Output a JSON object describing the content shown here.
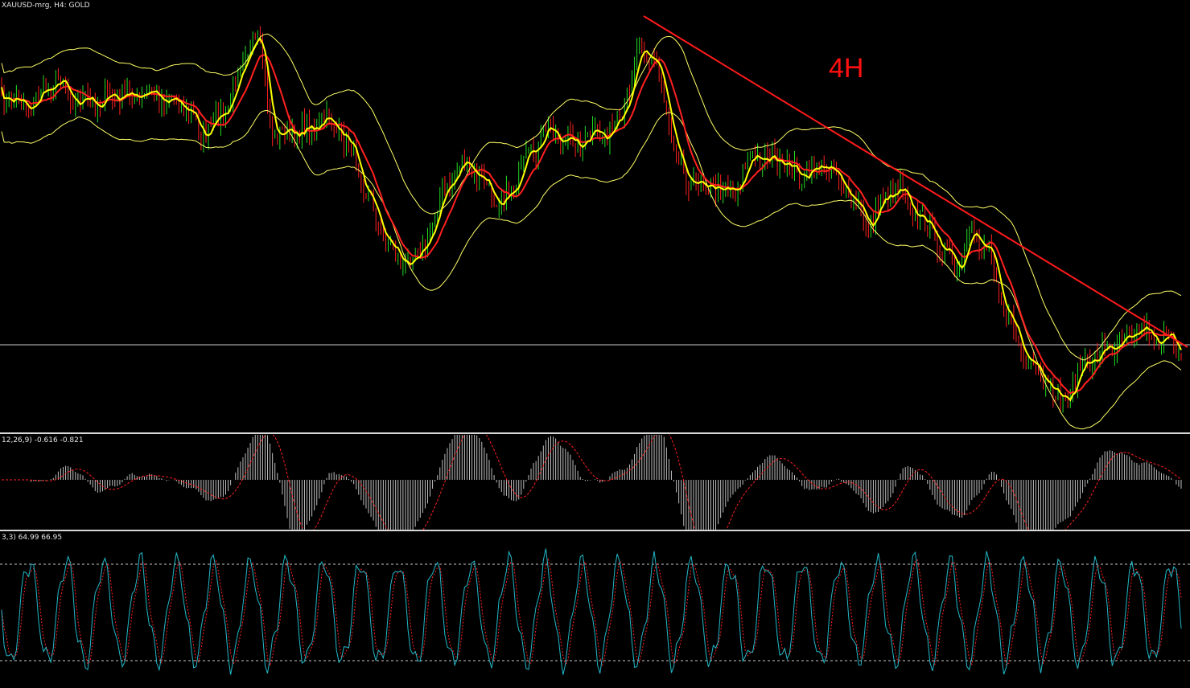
{
  "main": {
    "header_label": "XAUUSD-mrg, H4:  GOLD",
    "timeframe_annotation": "4H"
  },
  "macd": {
    "header_label": "12,26,9) -0.616 -0.821"
  },
  "stochastic": {
    "header_label": "3,3) 64.99 66.95"
  },
  "colors": {
    "background": "#000000",
    "bull_candle": "#22dd22",
    "bear_candle": "#ff2020",
    "fast_ma": "#ffff00",
    "slow_ma": "#ff2020",
    "bollinger": "#ffff66",
    "trendline": "#ff1a1a",
    "horizontal_line": "#c8c8c8",
    "macd_histogram": "#bfbfbf",
    "macd_signal": "#ff2020",
    "stoch_main": "#22b8c8",
    "stoch_signal": "#ff2020",
    "stoch_levels": "#c8c8c8"
  }
}
